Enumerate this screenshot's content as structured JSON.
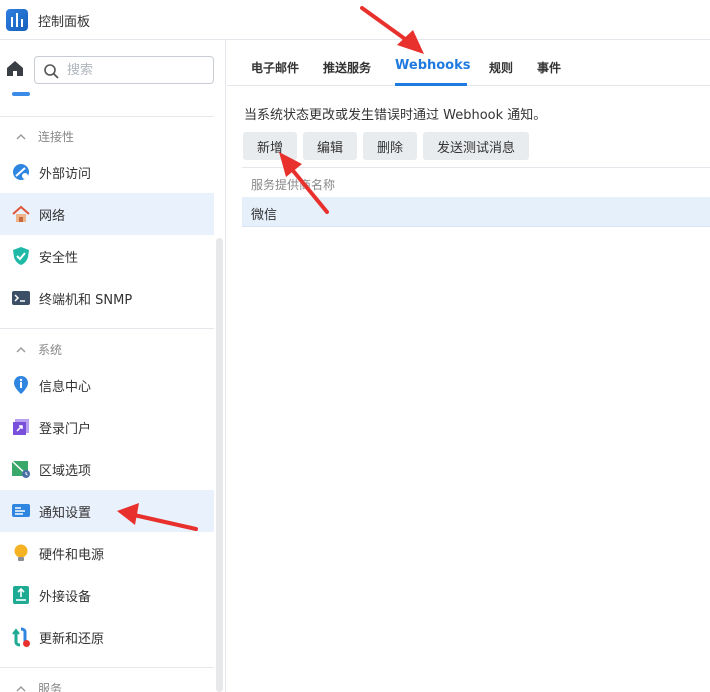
{
  "window": {
    "title": "控制面板"
  },
  "search": {
    "placeholder": "搜索"
  },
  "sidebar": {
    "sections": [
      {
        "label": "连接性",
        "items": [
          {
            "label": "外部访问",
            "icon": "external-access-icon",
            "active": false
          },
          {
            "label": "网络",
            "icon": "network-house-icon",
            "active": false
          },
          {
            "label": "安全性",
            "icon": "shield-icon",
            "active": false
          },
          {
            "label": "终端机和 SNMP",
            "icon": "terminal-icon",
            "active": false
          }
        ]
      },
      {
        "label": "系统",
        "items": [
          {
            "label": "信息中心",
            "icon": "info-pin-icon",
            "active": false
          },
          {
            "label": "登录门户",
            "icon": "login-portal-icon",
            "active": false
          },
          {
            "label": "区域选项",
            "icon": "regional-map-icon",
            "active": false
          },
          {
            "label": "通知设置",
            "icon": "notification-icon",
            "active": true
          },
          {
            "label": "硬件和电源",
            "icon": "lightbulb-icon",
            "active": false
          },
          {
            "label": "外接设备",
            "icon": "external-device-icon",
            "active": false
          },
          {
            "label": "更新和还原",
            "icon": "update-restore-icon",
            "active": false
          }
        ]
      },
      {
        "label": "服务",
        "items": []
      }
    ]
  },
  "tabs": [
    {
      "label": "电子邮件",
      "active": false
    },
    {
      "label": "推送服务",
      "active": false
    },
    {
      "label": "Webhooks",
      "active": true
    },
    {
      "label": "规则",
      "active": false
    },
    {
      "label": "事件",
      "active": false
    }
  ],
  "main": {
    "description": "当系统状态更改或发生错误时通过 Webhook 通知。",
    "buttons": {
      "add": "新增",
      "edit": "编辑",
      "delete": "删除",
      "send_test": "发送测试消息"
    },
    "table": {
      "column": "服务提供商名称",
      "rows": [
        "微信"
      ]
    }
  },
  "colors": {
    "accent": "#1f7ae0",
    "active_bg": "#e8f1fc",
    "annotation_arrow": "#e8312d"
  }
}
